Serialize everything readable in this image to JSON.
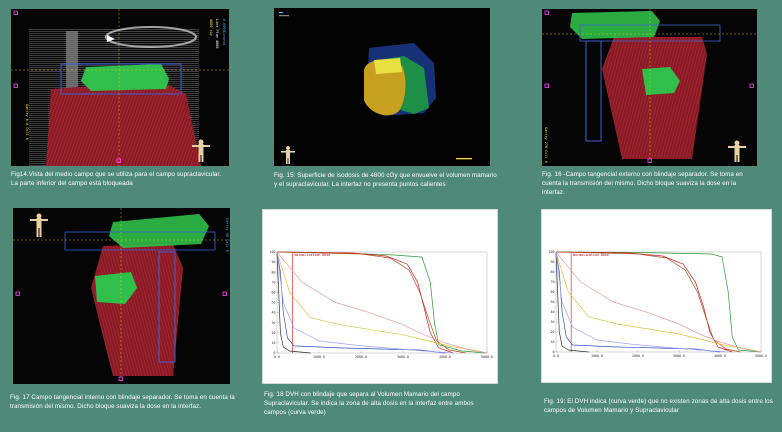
{
  "figures": [
    {
      "id": "fig14",
      "caption": "Fig14.Vista del medio campo que se utiliza para el campo supraclavicular. La parte inferior del campo está bloqueada"
    },
    {
      "id": "fig15",
      "caption": "Fig. 15:  Superficie de isodosis de 4800 cGy que envuelve el volumen mamario y el supraclavicular. La interfaz no presenta puntos calientes"
    },
    {
      "id": "fig16",
      "caption": "Fig. 16 -Campo tangencial externo con blindaje separador. Se toma en cuenta la transmisión del mismo. Dicho bloque suaviza  la dose en la interfaz."
    },
    {
      "id": "fig17",
      "caption": "Fig. 17 Campo tangencial interno con blindaje separador. Se toma en cuenta la transmisión del mismo. Dicho bloque suaviza  la dose en la interfaz."
    },
    {
      "id": "fig18",
      "caption": "Fig. 18 DVH  con blindaje que separa al Volumen Mamario del  campo Supraclavicular. Se indica la zona de alta dosis en la interfaz entre ambos campos (curva verde)"
    },
    {
      "id": "fig19",
      "caption": "Fig. 19:  El DVH indica (curva verde) que no existen zonas de alta dosis entre los campos de Volumen Mamario y Supraclavicular"
    }
  ],
  "dvh_legend": "Normalization Dose",
  "dvh_y_ticks": [
    "100",
    "90",
    "80",
    "70",
    "60",
    "50",
    "40",
    "30",
    "20",
    "10",
    "0"
  ],
  "dvh_x_ticks": [
    "0.0",
    "1000.0",
    "2000.0",
    "3000.0",
    "4000.0",
    "5000.0"
  ],
  "colors": {
    "background": "#4f8a78",
    "dose_red": "#8b1a26",
    "field_green": "#2fbf4a",
    "normalization_line": "#e03030"
  },
  "chart_data": [
    {
      "type": "line",
      "title": "",
      "xlabel": "",
      "ylabel": "",
      "xlim": [
        0,
        5000
      ],
      "ylim": [
        0,
        100
      ],
      "series": [
        {
          "color": "#2a9a3a",
          "points": [
            [
              0,
              100
            ],
            [
              1500,
              99
            ],
            [
              2800,
              97
            ],
            [
              3450,
              95
            ],
            [
              3650,
              70
            ],
            [
              3750,
              30
            ],
            [
              3850,
              8
            ],
            [
              4400,
              2
            ],
            [
              5000,
              0
            ]
          ]
        },
        {
          "color": "#d02020",
          "points": [
            [
              0,
              100
            ],
            [
              1800,
              99
            ],
            [
              2600,
              96
            ],
            [
              3100,
              88
            ],
            [
              3350,
              70
            ],
            [
              3500,
              45
            ],
            [
              3650,
              20
            ],
            [
              3850,
              5
            ],
            [
              4200,
              0
            ]
          ]
        },
        {
          "color": "#b05020",
          "points": [
            [
              0,
              100
            ],
            [
              2000,
              98
            ],
            [
              2700,
              94
            ],
            [
              3150,
              82
            ],
            [
              3400,
              60
            ],
            [
              3600,
              35
            ],
            [
              3800,
              12
            ],
            [
              4100,
              3
            ],
            [
              4500,
              0
            ]
          ]
        },
        {
          "color": "#e0c040",
          "points": [
            [
              0,
              100
            ],
            [
              300,
              60
            ],
            [
              800,
              35
            ],
            [
              1500,
              28
            ],
            [
              2400,
              22
            ],
            [
              3000,
              18
            ],
            [
              3600,
              12
            ],
            [
              4200,
              6
            ],
            [
              4800,
              2
            ],
            [
              5000,
              0
            ]
          ]
        },
        {
          "color": "#e0a0a0",
          "points": [
            [
              0,
              100
            ],
            [
              600,
              70
            ],
            [
              1400,
              50
            ],
            [
              2200,
              40
            ],
            [
              3000,
              28
            ],
            [
              3500,
              18
            ],
            [
              4000,
              10
            ],
            [
              4600,
              3
            ],
            [
              5000,
              0
            ]
          ]
        },
        {
          "color": "#3050c0",
          "points": [
            [
              0,
              100
            ],
            [
              80,
              80
            ],
            [
              150,
              40
            ],
            [
              250,
              15
            ],
            [
              400,
              7
            ],
            [
              1500,
              5
            ],
            [
              2500,
              4
            ],
            [
              3400,
              3
            ],
            [
              4000,
              0
            ]
          ]
        },
        {
          "color": "#303030",
          "points": [
            [
              0,
              100
            ],
            [
              40,
              60
            ],
            [
              80,
              20
            ],
            [
              150,
              6
            ],
            [
              300,
              2
            ],
            [
              800,
              0
            ]
          ]
        },
        {
          "color": "#a0a0ff",
          "points": [
            [
              0,
              100
            ],
            [
              150,
              50
            ],
            [
              400,
              25
            ],
            [
              1000,
              12
            ],
            [
              1800,
              8
            ],
            [
              2600,
              5
            ],
            [
              3500,
              2
            ],
            [
              4200,
              0
            ]
          ]
        }
      ],
      "markers": [
        {
          "x": 370,
          "label": "Normalization Dose"
        }
      ]
    },
    {
      "type": "line",
      "title": "",
      "xlabel": "",
      "ylabel": "",
      "xlim": [
        0,
        5000
      ],
      "ylim": [
        0,
        100
      ],
      "series": [
        {
          "color": "#2a9a3a",
          "points": [
            [
              0,
              100
            ],
            [
              2000,
              99.5
            ],
            [
              3800,
              98
            ],
            [
              4050,
              95
            ],
            [
              4200,
              60
            ],
            [
              4300,
              15
            ],
            [
              4450,
              2
            ],
            [
              5000,
              0
            ]
          ]
        },
        {
          "color": "#d02020",
          "points": [
            [
              0,
              100
            ],
            [
              1800,
              99
            ],
            [
              2600,
              96
            ],
            [
              3100,
              88
            ],
            [
              3400,
              70
            ],
            [
              3600,
              45
            ],
            [
              3750,
              20
            ],
            [
              3950,
              5
            ],
            [
              4300,
              0
            ]
          ]
        },
        {
          "color": "#b05020",
          "points": [
            [
              0,
              100
            ],
            [
              2000,
              98
            ],
            [
              2700,
              94
            ],
            [
              3150,
              82
            ],
            [
              3450,
              60
            ],
            [
              3650,
              35
            ],
            [
              3850,
              12
            ],
            [
              4150,
              3
            ],
            [
              4500,
              0
            ]
          ]
        },
        {
          "color": "#e0c040",
          "points": [
            [
              0,
              100
            ],
            [
              300,
              60
            ],
            [
              800,
              35
            ],
            [
              1500,
              28
            ],
            [
              2400,
              22
            ],
            [
              3000,
              18
            ],
            [
              3600,
              12
            ],
            [
              4200,
              6
            ],
            [
              4800,
              2
            ],
            [
              5000,
              0
            ]
          ]
        },
        {
          "color": "#e0a0a0",
          "points": [
            [
              0,
              100
            ],
            [
              600,
              70
            ],
            [
              1400,
              50
            ],
            [
              2200,
              40
            ],
            [
              3000,
              28
            ],
            [
              3500,
              18
            ],
            [
              4000,
              10
            ],
            [
              4600,
              3
            ],
            [
              5000,
              0
            ]
          ]
        },
        {
          "color": "#3050c0",
          "points": [
            [
              0,
              100
            ],
            [
              80,
              80
            ],
            [
              150,
              40
            ],
            [
              250,
              15
            ],
            [
              400,
              7
            ],
            [
              1500,
              5
            ],
            [
              2500,
              4
            ],
            [
              3400,
              3
            ],
            [
              4000,
              0
            ]
          ]
        },
        {
          "color": "#303030",
          "points": [
            [
              0,
              100
            ],
            [
              40,
              60
            ],
            [
              80,
              20
            ],
            [
              150,
              6
            ],
            [
              300,
              2
            ],
            [
              800,
              0
            ]
          ]
        },
        {
          "color": "#a0a0ff",
          "points": [
            [
              0,
              100
            ],
            [
              150,
              50
            ],
            [
              400,
              25
            ],
            [
              1000,
              12
            ],
            [
              1800,
              8
            ],
            [
              2600,
              5
            ],
            [
              3500,
              2
            ],
            [
              4200,
              0
            ]
          ]
        }
      ],
      "markers": [
        {
          "x": 370,
          "label": "Normalization Dose"
        }
      ]
    }
  ]
}
